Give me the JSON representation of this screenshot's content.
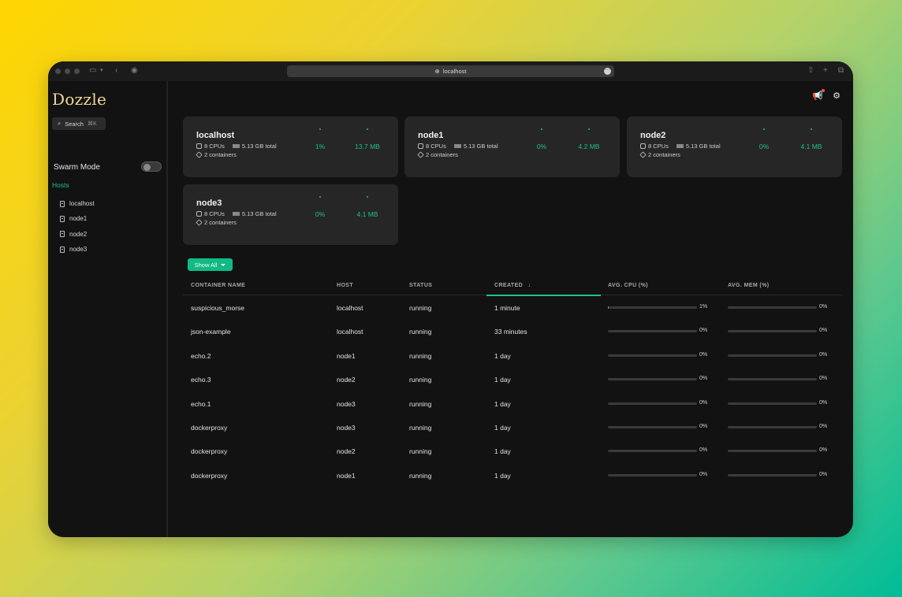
{
  "browser": {
    "url": "localhost"
  },
  "sidebar": {
    "logo": "Dozzle",
    "search_label": "Search",
    "search_shortcut": "⌘K",
    "swarm_mode_label": "Swarm Mode",
    "hosts_label": "Hosts",
    "hosts": [
      "localhost",
      "node1",
      "node2",
      "node3"
    ]
  },
  "host_cards": [
    {
      "name": "localhost",
      "cpus": "8 CPUs",
      "memory": "5.13 GB total",
      "containers": "2 containers",
      "cpu_usage": "1%",
      "mem_usage": "13.7 MB"
    },
    {
      "name": "node1",
      "cpus": "8 CPUs",
      "memory": "5.13 GB total",
      "containers": "2 containers",
      "cpu_usage": "0%",
      "mem_usage": "4.2 MB"
    },
    {
      "name": "node2",
      "cpus": "8 CPUs",
      "memory": "5.13 GB total",
      "containers": "2 containers",
      "cpu_usage": "0%",
      "mem_usage": "4.1 MB"
    },
    {
      "name": "node3",
      "cpus": "8 CPUs",
      "memory": "5.13 GB total",
      "containers": "2 containers",
      "cpu_usage": "0%",
      "mem_usage": "4.1 MB"
    }
  ],
  "filter": {
    "label": "Show All"
  },
  "table": {
    "headers": {
      "name": "CONTAINER NAME",
      "host": "HOST",
      "status": "STATUS",
      "created": "CREATED",
      "cpu": "AVG. CPU (%)",
      "mem": "AVG. MEM (%)"
    },
    "sort_icon": "arrow-down-icon",
    "rows": [
      {
        "name": "suspicious_morse",
        "host": "localhost",
        "status": "running",
        "created": "1 minute",
        "cpu": "1%",
        "cpu_value": 1,
        "mem": "0%",
        "mem_value": 0
      },
      {
        "name": "json-example",
        "host": "localhost",
        "status": "running",
        "created": "33 minutes",
        "cpu": "0%",
        "cpu_value": 0,
        "mem": "0%",
        "mem_value": 0
      },
      {
        "name": "echo.2",
        "host": "node1",
        "status": "running",
        "created": "1 day",
        "cpu": "0%",
        "cpu_value": 0,
        "mem": "0%",
        "mem_value": 0
      },
      {
        "name": "echo.3",
        "host": "node2",
        "status": "running",
        "created": "1 day",
        "cpu": "0%",
        "cpu_value": 0,
        "mem": "0%",
        "mem_value": 0
      },
      {
        "name": "echo.1",
        "host": "node3",
        "status": "running",
        "created": "1 day",
        "cpu": "0%",
        "cpu_value": 0,
        "mem": "0%",
        "mem_value": 0
      },
      {
        "name": "dockerproxy",
        "host": "node3",
        "status": "running",
        "created": "1 day",
        "cpu": "0%",
        "cpu_value": 0,
        "mem": "0%",
        "mem_value": 0
      },
      {
        "name": "dockerproxy",
        "host": "node2",
        "status": "running",
        "created": "1 day",
        "cpu": "0%",
        "cpu_value": 0,
        "mem": "0%",
        "mem_value": 0
      },
      {
        "name": "dockerproxy",
        "host": "node1",
        "status": "running",
        "created": "1 day",
        "cpu": "0%",
        "cpu_value": 0,
        "mem": "0%",
        "mem_value": 0
      }
    ]
  },
  "colors": {
    "accent": "#1ec08f",
    "logo": "#f1d89a",
    "background": "#121212",
    "card": "#262626"
  }
}
